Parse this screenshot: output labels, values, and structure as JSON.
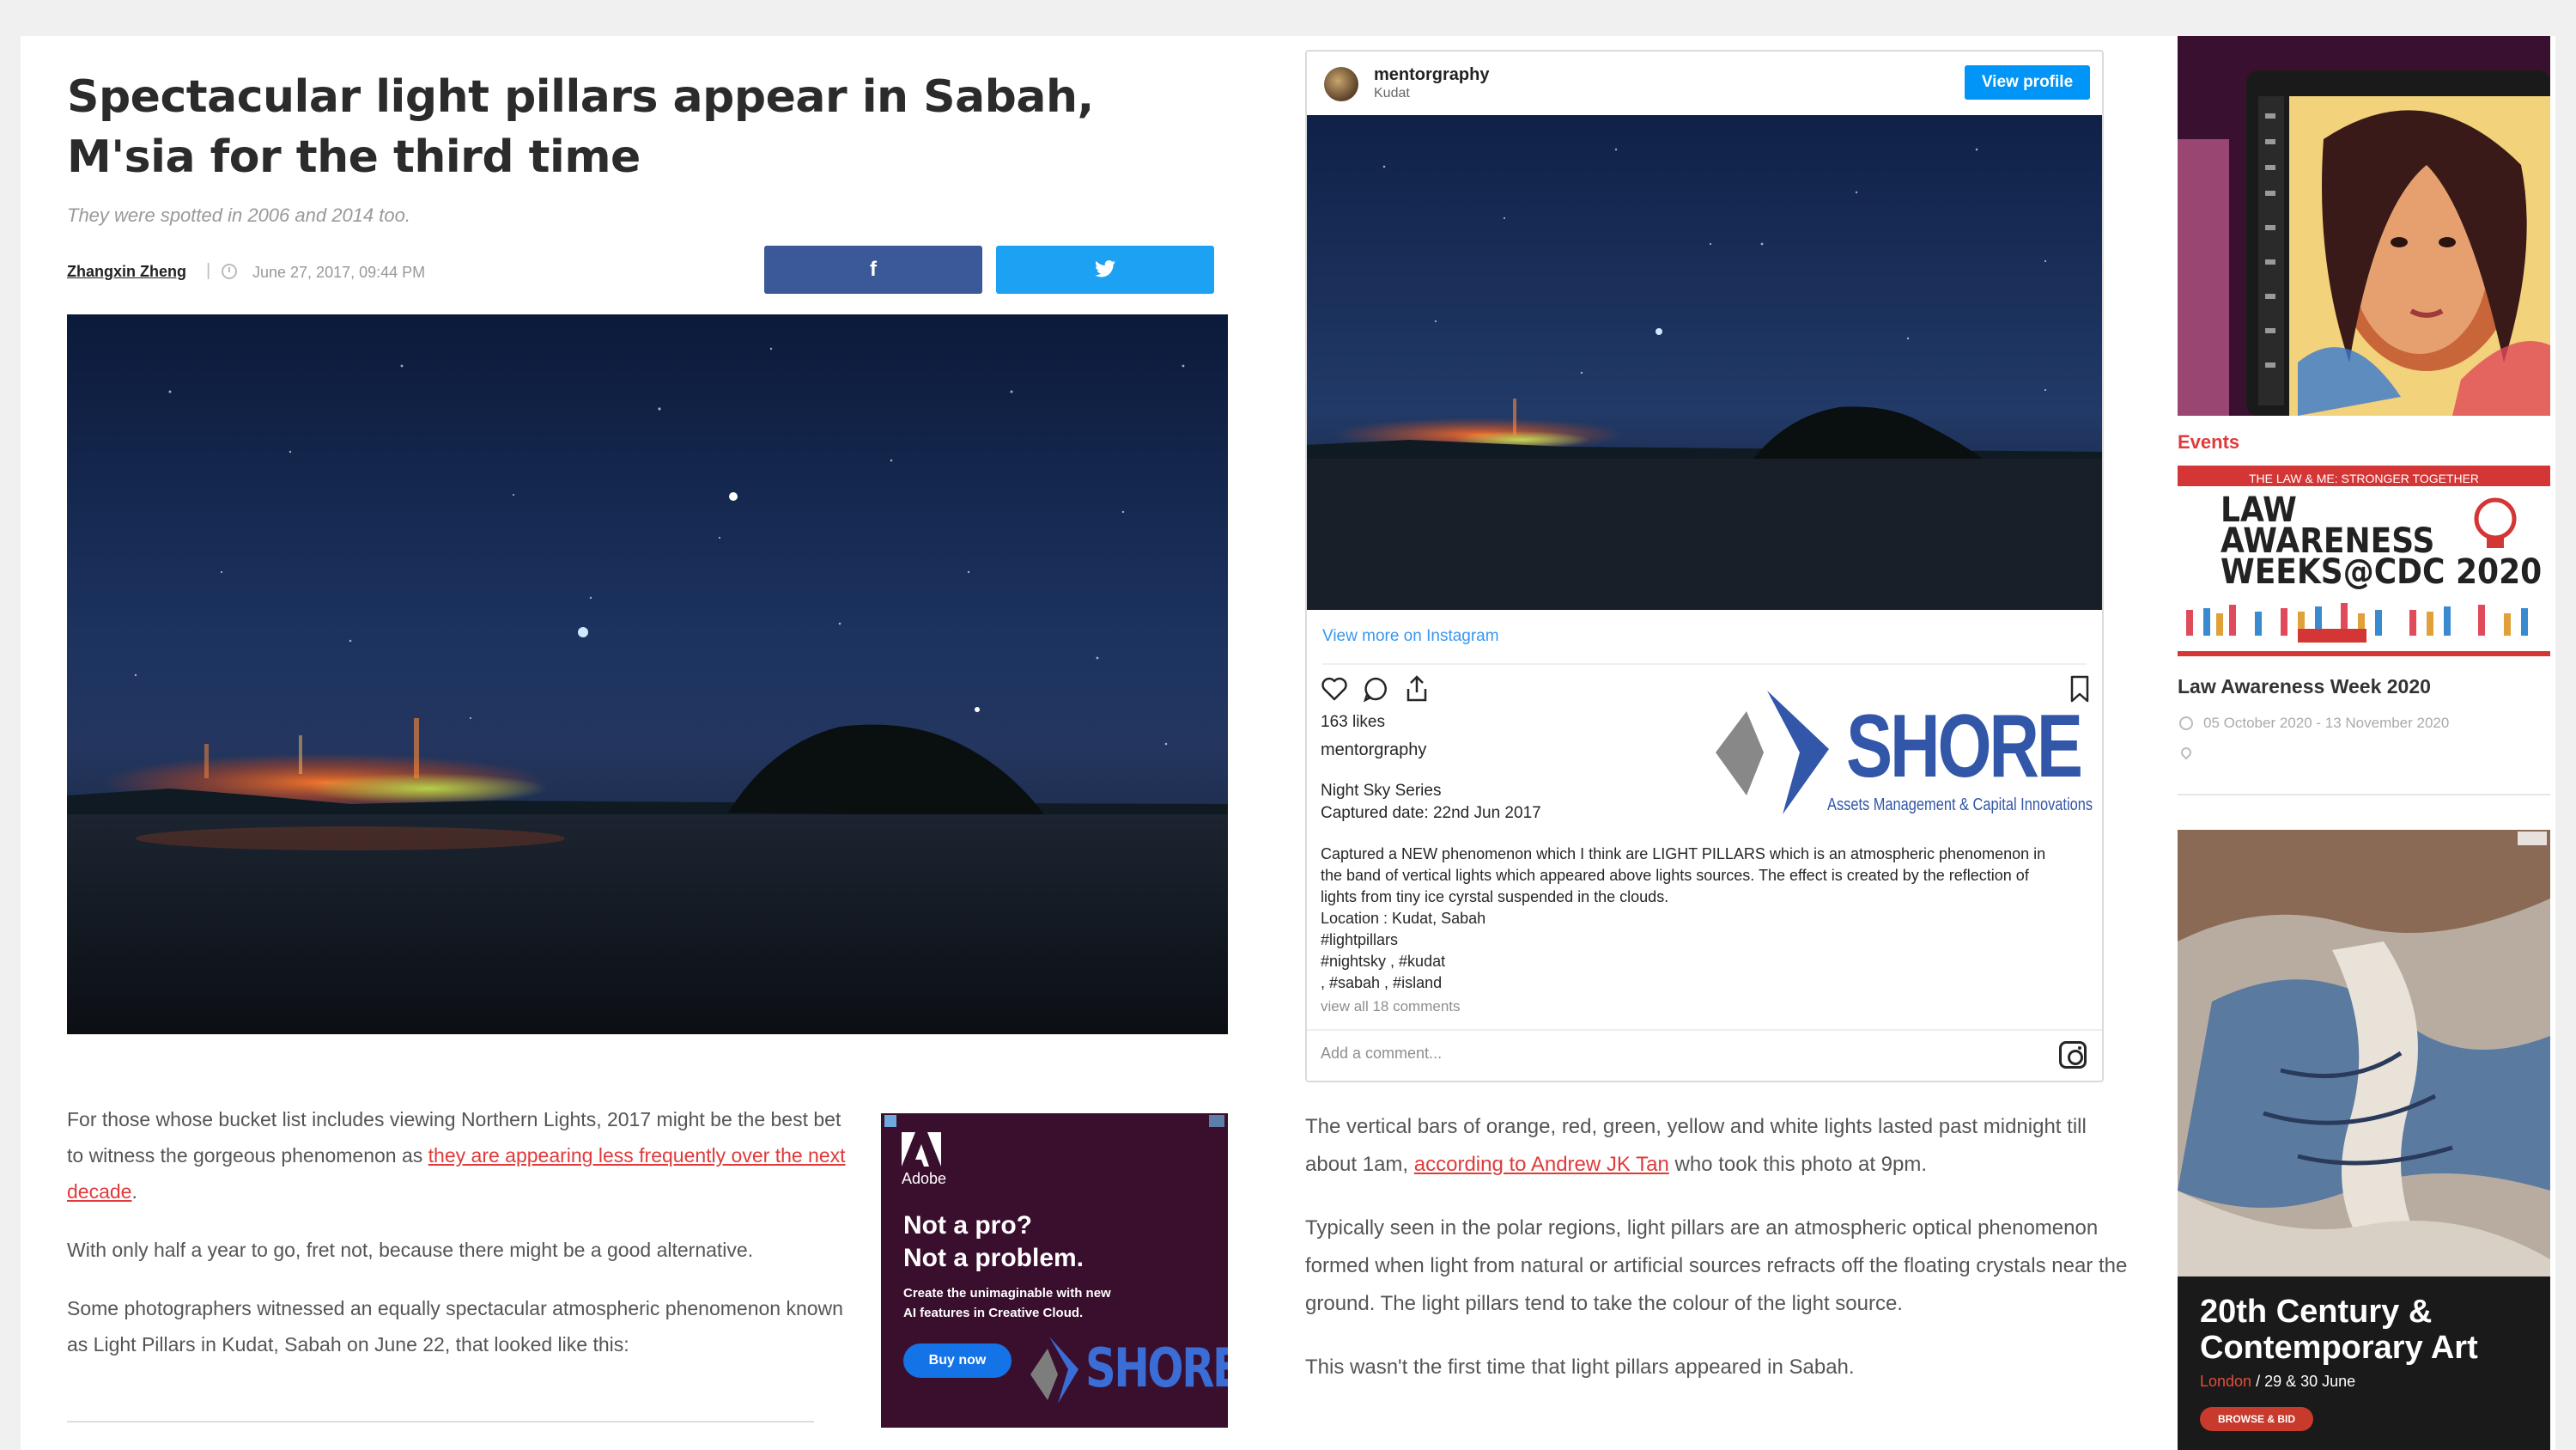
{
  "article": {
    "title": "Spectacular light pillars appear in Sabah, M'sia for the third time",
    "subtitle": "They were spotted in 2006 and 2014 too.",
    "author": "Zhangxin Zheng",
    "separator": "|",
    "date": "June 27, 2017, 09:44 PM",
    "share_facebook": "f",
    "share_twitter_icon": "twitter-bird-icon",
    "para1_start": "For those whose bucket list includes viewing Northern Lights, 2017 might be the best bet to witness the gorgeous phenomenon as ",
    "para1_link": "they are appearing less frequently over the next decade",
    "para1_end": ".",
    "para2": "With only half a year to go, fret not, because there might be a good alternative.",
    "para3": "Some photographers witnessed an equally spectacular atmospheric phenomenon known as Light Pillars in Kudat, Sabah on June 22, that looked like this:",
    "para4_start": "The vertical bars of orange, red, green, yellow and white lights lasted past midnight till about 1am, ",
    "para4_link": "according to Andrew JK Tan",
    "para4_end": " who took this photo at 9pm.",
    "para5": "Typically seen in the polar regions, light pillars are an atmospheric optical phenomenon formed when light from natural or artificial sources refracts off the floating crystals near the ground. The light pillars tend to take the colour of the light source.",
    "para6": "This wasn't the first time that light pillars appeared in Sabah."
  },
  "ad_adobe": {
    "brand": "Adobe",
    "headline_1": "Not a pro?",
    "headline_2": "Not a problem.",
    "sub_1": "Create the unimaginable with new",
    "sub_2": "AI features in Creative Cloud.",
    "button": "Buy now",
    "shore": "SHORE"
  },
  "instagram": {
    "username": "mentorgraphy",
    "location": "Kudat",
    "view_profile": "View profile",
    "view_more": "View more on Instagram",
    "likes": "163 likes",
    "caption_user": "mentorgraphy",
    "series": "Night Sky Series",
    "captured": "Captured date: 22nd Jun 2017",
    "caption": "Captured a NEW phenomenon which I think are LIGHT PILLARS which is an atmospheric phenomenon in the band of vertical lights which appeared above lights sources. The effect is created by the reflection of lights from tiny ice cyrstal suspended in the clouds.",
    "location_line": "Location : Kudat, Sabah",
    "tags_1": "#lightpillars",
    "tags_2": "#nightsky , #kudat",
    "tags_3": ", #sabah , #island",
    "comments": "view all 18 comments",
    "add_comment": "Add a comment..."
  },
  "shore_logo": {
    "name": "SHORE",
    "tagline": "Assets Management & Capital Innovations"
  },
  "sidebar": {
    "events_label": "Events",
    "banner_top": "THE LAW & ME: STRONGER TOGETHER",
    "banner_l1": "LAW",
    "banner_l2": "AWARENESS",
    "banner_l3": "WEEKS@CDC 2020",
    "event_title": "Law Awareness Week 2020",
    "event_date": "05 October 2020 - 13 November 2020",
    "ad2_title_1": "20th Century &",
    "ad2_title_2": "Contemporary Art",
    "ad2_loc_city": "London",
    "ad2_loc_date": " / 29 & 30 June",
    "ad2_button": "BROWSE & BID"
  },
  "colors": {
    "facebook": "#3b5998",
    "twitter": "#1da1f2",
    "link_red": "#e03a3a",
    "instagram_blue": "#0095f6",
    "shore_blue": "#3256a8"
  }
}
